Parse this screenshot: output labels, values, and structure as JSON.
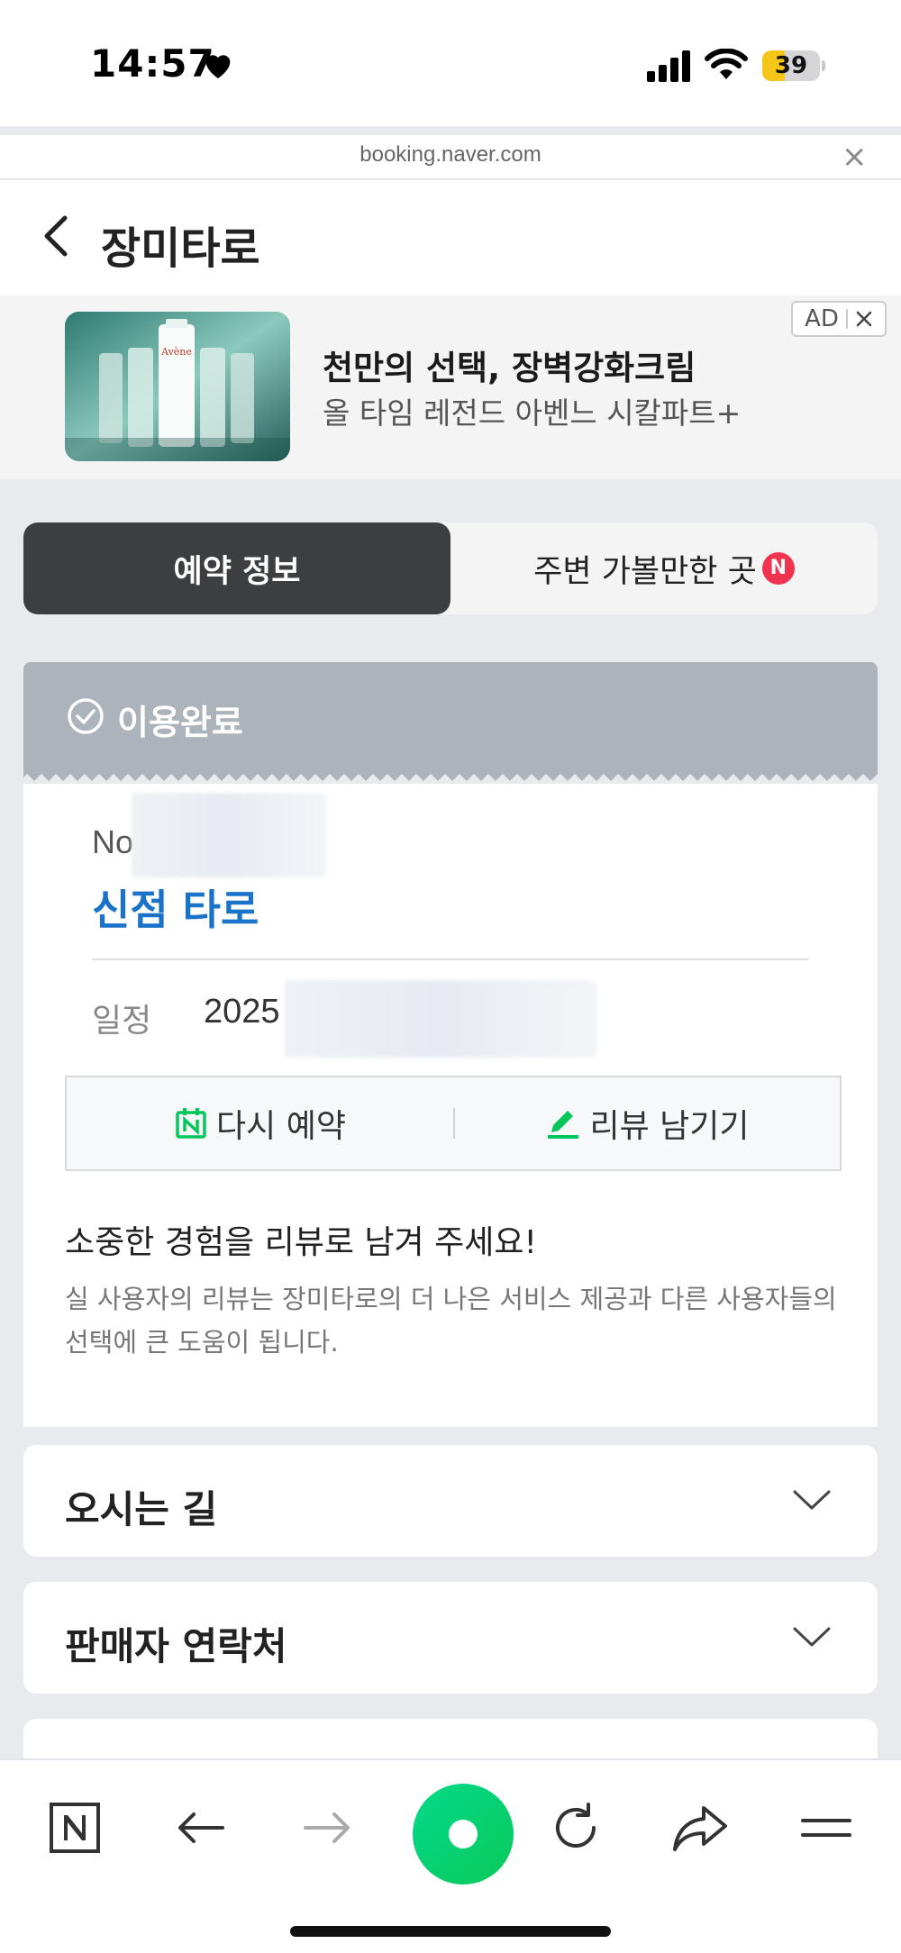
{
  "status_bar": {
    "time": "14:57",
    "battery": "39",
    "battery_level": 0.39
  },
  "browser": {
    "url": "booking.naver.com",
    "close_label": "×"
  },
  "header": {
    "title": "장미타로"
  },
  "ad": {
    "headline": "천만의 선택, 장벽강화크림",
    "subtext": "올 타임 레전드 아벤느 시칼파트+",
    "badge_label": "AD",
    "brand_on_image": "Avène"
  },
  "tabs": [
    {
      "label": "예약 정보",
      "active": true
    },
    {
      "label": "주변 가볼만한 곳",
      "badge": "N",
      "active": false
    }
  ],
  "booking": {
    "status": "이용완료",
    "number_prefix": "No.",
    "product_name": "신점 타로",
    "date_label": "일정",
    "date_value": "2025",
    "rebook_label": "다시 예약",
    "review_label": "리뷰 남기기",
    "review_title": "소중한 경험을 리뷰로 남겨 주세요!",
    "review_desc": "실 사용자의 리뷰는 장미타로의 더 나은 서비스 제공과 다른 사용자들의 선택에 큰 도움이 됩니다."
  },
  "sections": [
    {
      "title": "오시는 길"
    },
    {
      "title": "판매자 연락처"
    }
  ],
  "colors": {
    "accent_blue": "#1a73c8",
    "naver_green": "#03c75a",
    "tab_active_bg": "#3d3e40",
    "status_banner_bg": "#adb3bb",
    "new_badge": "#f0334f"
  },
  "bottom_nav": [
    "naver-home-icon",
    "back-arrow-icon",
    "forward-arrow-icon",
    "green-dot-icon",
    "refresh-icon",
    "share-icon",
    "menu-icon"
  ]
}
